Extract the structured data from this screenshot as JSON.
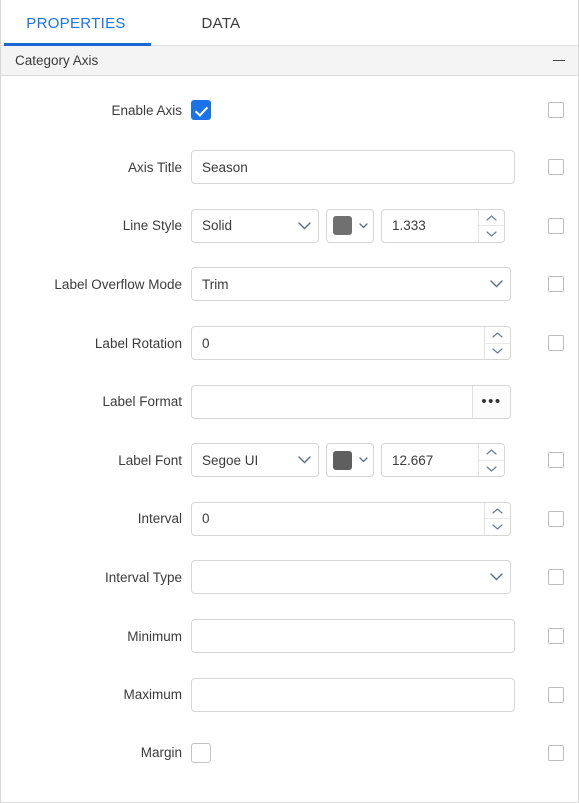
{
  "tabs": [
    {
      "label": "PROPERTIES",
      "active": true
    },
    {
      "label": "DATA",
      "active": false
    }
  ],
  "section": {
    "title": "Category Axis",
    "collapse_icon": "minus-icon",
    "collapsed": false
  },
  "accent_color": "#1967d2",
  "rows": {
    "enable_axis": {
      "label": "Enable Axis",
      "checkbox_checked": true,
      "trailing_checkbox": false
    },
    "axis_title": {
      "label": "Axis Title",
      "value": "Season",
      "placeholder": "",
      "trailing_checkbox": false
    },
    "line_style": {
      "label": "Line Style",
      "value": "Solid",
      "color": "#707070",
      "width": "1.333",
      "trailing_checkbox": false
    },
    "label_overflow_mode": {
      "label": "Label Overflow Mode",
      "value": "Trim",
      "trailing_checkbox": false
    },
    "label_rotation": {
      "label": "Label Rotation",
      "value": "0",
      "trailing_checkbox": false
    },
    "label_format": {
      "label": "Label Format",
      "value": "",
      "ellipsis_label": "•••"
    },
    "label_font": {
      "label": "Label Font",
      "value": "Segoe UI",
      "color": "#5f5f5f",
      "size": "12.667",
      "trailing_checkbox": false
    },
    "interval": {
      "label": "Interval",
      "value": "0",
      "trailing_checkbox": false
    },
    "interval_type": {
      "label": "Interval Type",
      "value": "",
      "trailing_checkbox": false
    },
    "minimum": {
      "label": "Minimum",
      "value": "",
      "trailing_checkbox": false
    },
    "maximum": {
      "label": "Maximum",
      "value": "",
      "trailing_checkbox": false
    },
    "margin": {
      "label": "Margin",
      "checkbox_checked": false,
      "trailing_checkbox": false
    }
  }
}
